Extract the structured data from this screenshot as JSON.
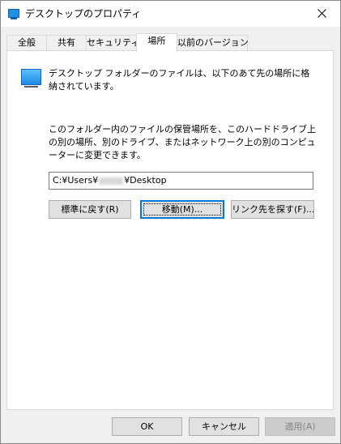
{
  "window": {
    "title": "デスクトップのプロパティ"
  },
  "tabs": [
    {
      "label": "全般"
    },
    {
      "label": "共有"
    },
    {
      "label": "セキュリティ"
    },
    {
      "label": "場所",
      "active": true
    },
    {
      "label": "以前のバージョン"
    }
  ],
  "location": {
    "description_1": "デスクトップ フォルダーのファイルは、以下のあて先の場所に格納されています。",
    "description_2": "このフォルダー内のファイルの保管場所を、このハードドライブ上の別の場所、別のドライブ、またはネットワーク上の別のコンピューターに変更できます。",
    "path_prefix": "C:¥Users¥",
    "path_suffix": "¥Desktop",
    "restore_default_label": "標準に戻す(R)",
    "move_label": "移動(M)...",
    "find_target_label": "リンク先を探す(F)..."
  },
  "footer": {
    "ok_label": "OK",
    "cancel_label": "キャンセル",
    "apply_label": "適用(A)"
  },
  "colors": {
    "accent": "#0078d7",
    "folder_icon": "#1e88e5"
  }
}
